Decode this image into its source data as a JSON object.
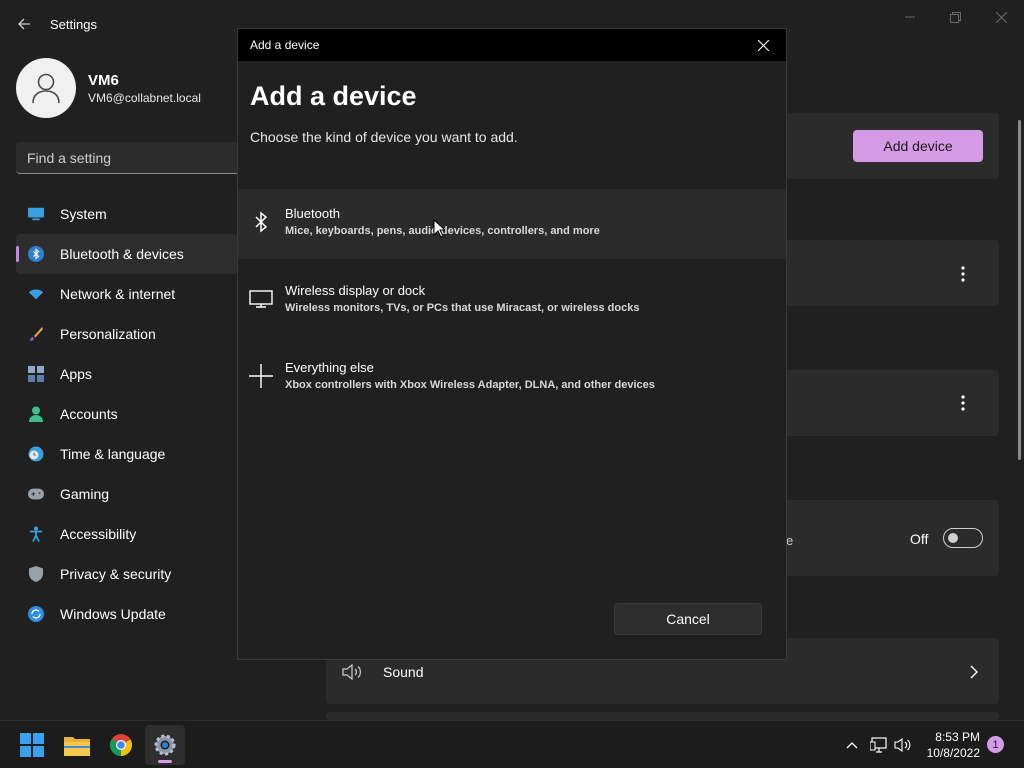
{
  "window": {
    "title": "Settings"
  },
  "user": {
    "name": "VM6",
    "email": "VM6@collabnet.local"
  },
  "search": {
    "placeholder": "Find a setting"
  },
  "sidebar": {
    "items": [
      {
        "label": "System",
        "icon": "monitor-icon",
        "active": false
      },
      {
        "label": "Bluetooth & devices",
        "icon": "bluetooth-icon",
        "active": true
      },
      {
        "label": "Network & internet",
        "icon": "wifi-icon",
        "active": false
      },
      {
        "label": "Personalization",
        "icon": "brush-icon",
        "active": false
      },
      {
        "label": "Apps",
        "icon": "apps-icon",
        "active": false
      },
      {
        "label": "Accounts",
        "icon": "person-icon",
        "active": false
      },
      {
        "label": "Time & language",
        "icon": "clock-globe-icon",
        "active": false
      },
      {
        "label": "Gaming",
        "icon": "gamepad-icon",
        "active": false
      },
      {
        "label": "Accessibility",
        "icon": "accessibility-icon",
        "active": false
      },
      {
        "label": "Privacy & security",
        "icon": "shield-icon",
        "active": false
      },
      {
        "label": "Windows Update",
        "icon": "update-icon",
        "active": false
      }
    ]
  },
  "main": {
    "add_device_label": "Add device",
    "partial_text": "e",
    "toggle_label": "Off",
    "toggle_on": false,
    "sound_label": "Sound"
  },
  "dialog": {
    "titlebar": "Add a device",
    "heading": "Add a device",
    "subtitle": "Choose the kind of device you want to add.",
    "options": [
      {
        "title": "Bluetooth",
        "description": "Mice, keyboards, pens, audio devices, controllers, and more",
        "icon": "bluetooth-icon"
      },
      {
        "title": "Wireless display or dock",
        "description": "Wireless monitors, TVs, or PCs that use Miracast, or wireless docks",
        "icon": "monitor-icon"
      },
      {
        "title": "Everything else",
        "description": "Xbox controllers with Xbox Wireless Adapter, DLNA, and other devices",
        "icon": "plus-icon"
      }
    ],
    "cancel_label": "Cancel"
  },
  "taskbar": {
    "apps": [
      "start-icon",
      "file-explorer-icon",
      "chrome-icon",
      "settings-icon"
    ],
    "time": "8:53 PM",
    "date": "10/8/2022",
    "notification_count": "1"
  },
  "colors": {
    "accent": "#d59be6",
    "background": "#202020",
    "card": "#2b2b2b"
  }
}
